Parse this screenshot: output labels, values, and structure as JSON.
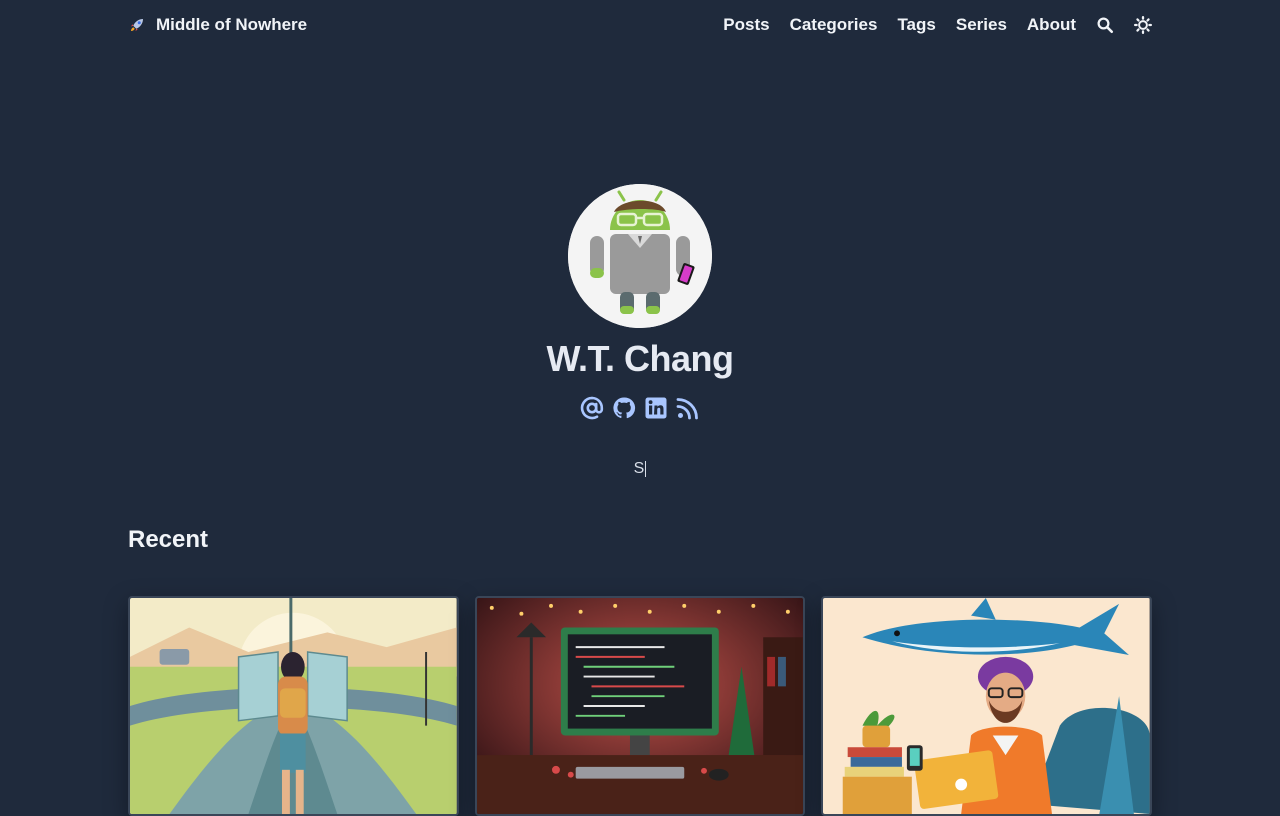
{
  "site": {
    "title": "Middle of Nowhere",
    "logo_icon": "rocket-icon"
  },
  "nav": {
    "items": [
      {
        "label": "Posts"
      },
      {
        "label": "Categories"
      },
      {
        "label": "Tags"
      },
      {
        "label": "Series"
      },
      {
        "label": "About"
      }
    ],
    "search_icon": "search-icon",
    "theme_icon": "sun-icon"
  },
  "profile": {
    "name": "W.T. Chang",
    "avatar": "android-avatar",
    "socials": [
      {
        "icon": "email-icon"
      },
      {
        "icon": "github-icon"
      },
      {
        "icon": "linkedin-icon"
      },
      {
        "icon": "rss-icon"
      }
    ],
    "typed_text": "S"
  },
  "recent": {
    "title": "Recent",
    "cards": [
      {
        "image": "crossroads-map-illustration"
      },
      {
        "image": "christmas-coding-desk-illustration"
      },
      {
        "image": "shark-developer-illustration"
      }
    ]
  },
  "colors": {
    "background": "#1f2a3c",
    "text": "#f1f4f8",
    "accent_icon": "#a9c6ff"
  }
}
